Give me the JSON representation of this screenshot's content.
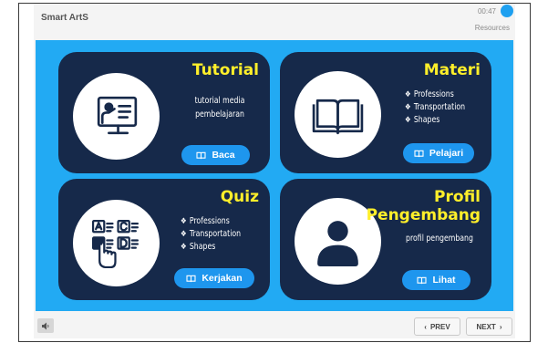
{
  "app": {
    "title": "Smart ArtS",
    "timer": "00:47",
    "resources_label": "Resources"
  },
  "cards": {
    "tutorial": {
      "title": "Tutorial",
      "description_lines": [
        "tutorial media",
        "pembelajaran"
      ],
      "button_label": "Baca",
      "icon": "teacher-presentation-icon"
    },
    "materi": {
      "title": "Materi",
      "bullets": [
        "Professions",
        "Transportation",
        "Shapes"
      ],
      "button_label": "Pelajari",
      "icon": "open-book-icon"
    },
    "quiz": {
      "title": "Quiz",
      "bullets": [
        "Professions",
        "Transportation",
        "Shapes"
      ],
      "button_label": "Kerjakan",
      "icon": "quiz-choice-icon"
    },
    "profil": {
      "title_lines": [
        "Profil",
        "Pengembang"
      ],
      "description": "profil pengembang",
      "button_label": "Lihat",
      "icon": "user-icon"
    }
  },
  "footer": {
    "prev_label": "PREV",
    "next_label": "NEXT"
  },
  "colors": {
    "stage": "#22aaf3",
    "card": "#16294a",
    "title": "#ffef2a",
    "button": "#1e96ee"
  }
}
